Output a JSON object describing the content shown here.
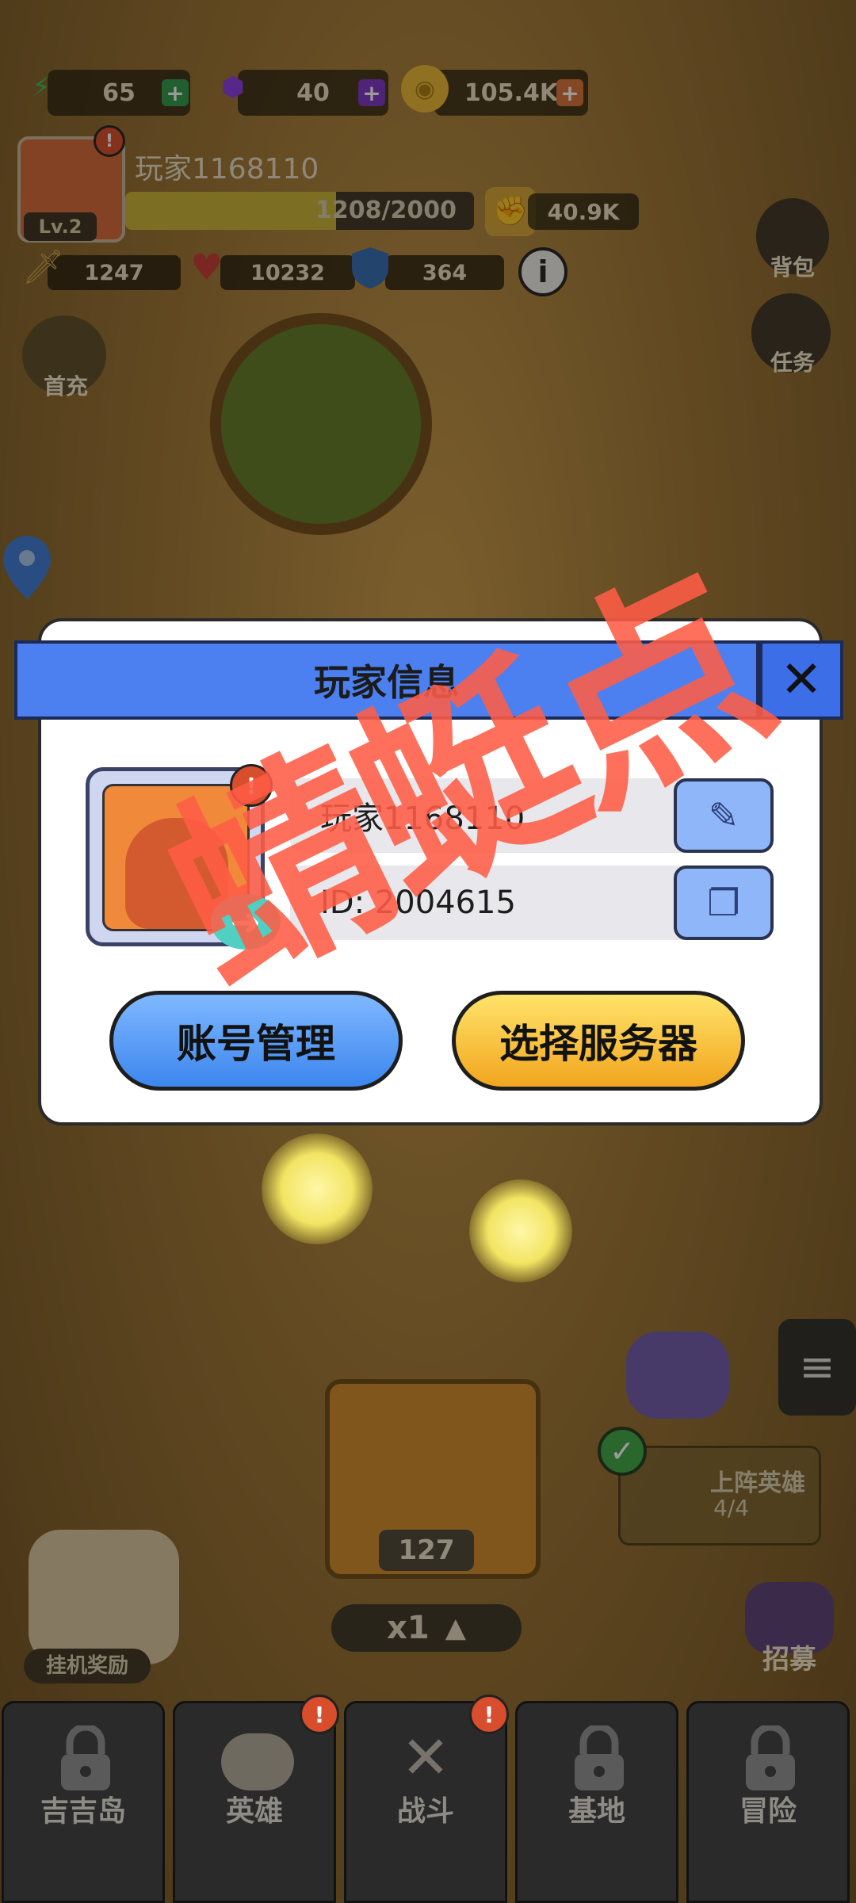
{
  "resources": [
    {
      "icon": "lightning-icon",
      "value": "65",
      "color": "#3fd06b"
    },
    {
      "icon": "gem-icon",
      "value": "40",
      "color": "#9a3ff0"
    },
    {
      "icon": "coin-icon",
      "value": "105.4K",
      "color": "#f5c541"
    }
  ],
  "player": {
    "name": "玩家1168110",
    "level": "Lv.2",
    "exp": "1208/2000",
    "exp_fraction": 0.604,
    "power": "40.9K"
  },
  "stats": [
    {
      "icon": "sword-icon",
      "value": "1247"
    },
    {
      "icon": "heart-icon",
      "value": "10232"
    },
    {
      "icon": "shield-icon",
      "value": "364"
    }
  ],
  "side": {
    "first_charge": "首充",
    "backpack": "背包",
    "tasks": "任务",
    "idle_reward": "挂机奖励",
    "recruit": "招募",
    "hero_deploy": "上阵英雄",
    "hero_count": "4/4"
  },
  "chest_count": "127",
  "speed": "x1",
  "dialog": {
    "title": "玩家信息",
    "close": "✕",
    "name_value": "玩家1168110",
    "id_value": "ID: 2004615",
    "left_button": "账号管理",
    "right_button": "选择服务器"
  },
  "watermark": "蜻蜓点",
  "nav": [
    {
      "label": "吉吉岛",
      "locked": true
    },
    {
      "label": "英雄",
      "locked": false
    },
    {
      "label": "战斗",
      "locked": false
    },
    {
      "label": "基地",
      "locked": true
    },
    {
      "label": "冒险",
      "locked": true
    }
  ]
}
